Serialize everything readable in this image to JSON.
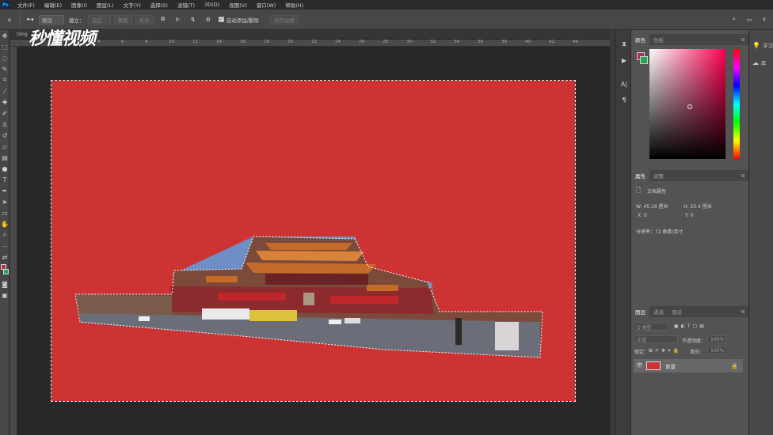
{
  "app": {
    "logo": "Ps"
  },
  "menu": [
    "文件(F)",
    "编辑(E)",
    "图像(I)",
    "图层(L)",
    "文字(Y)",
    "选择(S)",
    "滤镜(T)",
    "3D(D)",
    "视图(V)",
    "窗口(W)",
    "帮助(H)"
  ],
  "options": {
    "path_mode": "路径",
    "build_label": "建立：",
    "selection_btn": "选区...",
    "mask_btn": "蒙版",
    "shape_btn": "形状",
    "auto_add_delete": "自动添加/删除",
    "align_edges": "对齐边缘"
  },
  "document": {
    "tab_title": "timg",
    "canvas_color": "#ce3334"
  },
  "ruler_ticks": [
    "0",
    "2",
    "4",
    "6",
    "8",
    "10",
    "12",
    "14",
    "16",
    "18",
    "20",
    "22",
    "24",
    "26",
    "28",
    "30",
    "32",
    "34",
    "36",
    "38",
    "40",
    "42",
    "44"
  ],
  "watermark": "秒懂视频",
  "color_panel": {
    "tabs": [
      "颜色",
      "色板"
    ],
    "foreground": "#b5304a",
    "background": "#1fa84f"
  },
  "properties_panel": {
    "tabs": [
      "属性",
      "调整"
    ],
    "title": "文档属性",
    "w": "W: 45.16 厘米",
    "h": "H: 25.4 厘米",
    "x": "X: 0",
    "y": "Y: 0",
    "resolution": "分辨率：72 像素/英寸"
  },
  "layers_panel": {
    "tabs": [
      "图层",
      "通道",
      "路径"
    ],
    "filter_kind": "Q 类型",
    "blend_mode": "正常",
    "opacity_label": "不透明度：",
    "opacity_value": "100%",
    "lock_label": "锁定：",
    "fill_label": "填充：",
    "fill_value": "100%",
    "layer_name": "背景"
  },
  "far_right": [
    {
      "icon": "bulb-icon",
      "label": "学习"
    },
    {
      "icon": "library-icon",
      "label": "库"
    }
  ]
}
